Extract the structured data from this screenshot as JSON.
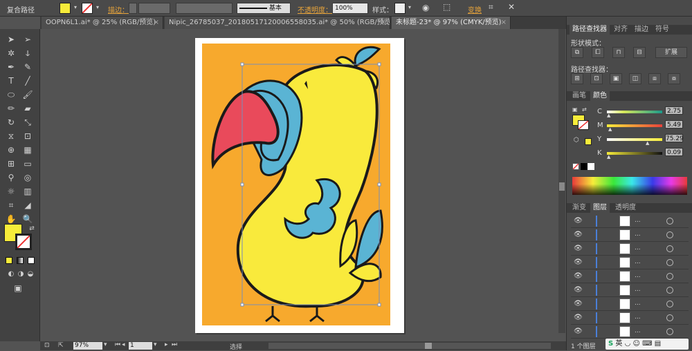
{
  "control_bar": {
    "selection_label": "复合路径",
    "stroke_label": "描边：",
    "opacity_label": "不透明度：",
    "opacity_value": "100%",
    "style_label": "样式：",
    "stroke_profile": "基本",
    "transform_label": "变换",
    "fill_color": "#f7ec3a"
  },
  "tabs": [
    {
      "label": "OOPN6L1.ai* @ 25% (RGB/预览)"
    },
    {
      "label": "Nipic_26785037_20180517120006558035.ai* @ 50% (RGB/预览)"
    },
    {
      "label": "未标题-23* @ 97% (CMYK/预览)"
    }
  ],
  "status": {
    "zoom": "97%",
    "page": "1",
    "tool_name": "选择"
  },
  "pathfinder": {
    "tabs": [
      "路径查找器",
      "对齐",
      "描边",
      "符号"
    ],
    "shape_modes_label": "形状模式：",
    "expand_label": "扩展",
    "pathfinders_label": "路径查找器："
  },
  "color_panel": {
    "tabs": [
      "画笔",
      "颜色"
    ],
    "channels": [
      {
        "name": "C",
        "value": "2.75"
      },
      {
        "name": "M",
        "value": "5.49"
      },
      {
        "name": "Y",
        "value": "75.29"
      },
      {
        "name": "K",
        "value": "0.09"
      }
    ]
  },
  "layers_panel": {
    "tabs": [
      "渐变",
      "图层",
      "透明度"
    ],
    "rows": [
      {
        "name": "..."
      },
      {
        "name": "..."
      },
      {
        "name": "..."
      },
      {
        "name": "..."
      },
      {
        "name": "..."
      },
      {
        "name": "..."
      },
      {
        "name": "..."
      },
      {
        "name": "..."
      },
      {
        "name": "..."
      }
    ],
    "count_label": "1 个图层"
  },
  "ime": {
    "label": "英"
  },
  "colors": {
    "accent_orange": "#e8a43a",
    "artboard_bg": "#f7a92d",
    "parrot_yellow": "#f9ea3c",
    "parrot_blue": "#5ab4d4",
    "parrot_red": "#e94a5b"
  }
}
